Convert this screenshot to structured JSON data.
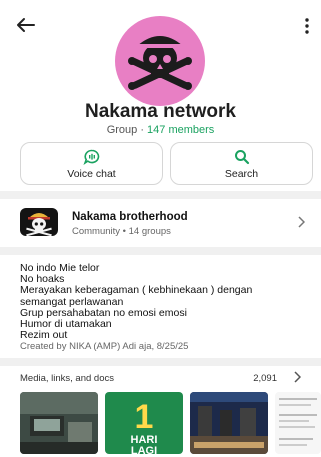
{
  "group": {
    "name": "Nakama network",
    "type_label": "Group · ",
    "members_label": "147 members"
  },
  "actions": {
    "voice_chat": "Voice chat",
    "search": "Search"
  },
  "community": {
    "name": "Nakama brotherhood",
    "subtitle": "Community • 14 groups"
  },
  "description": [
    "No indo Mie telor",
    "No hoaks",
    "Merayakan keberagaman ( kebhinekaan ) dengan",
    "semangat perlawanan",
    "Grup persahabatan no emosi emosi",
    "Humor di utamakan",
    "Rezim out"
  ],
  "created_by": "Created by NIKA (AMP) Adi aja, 8/25/25",
  "media": {
    "heading": "Media, links, and docs",
    "count": "2,091",
    "thumb2_text": [
      "1",
      "HARI",
      "LAGI"
    ]
  },
  "colors": {
    "accent": "#1aa260",
    "avatar_bg": "#e87fc4"
  },
  "icons": [
    "back-arrow-icon",
    "more-vert-icon",
    "voice-chat-icon",
    "search-icon",
    "chevron-right-icon"
  ]
}
